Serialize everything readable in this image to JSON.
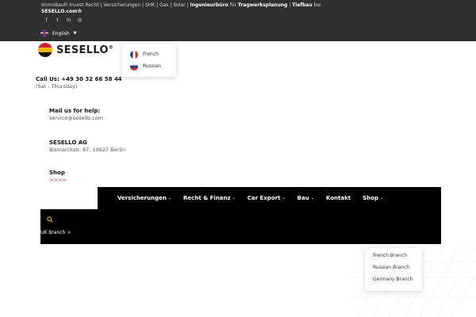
{
  "topbar": {
    "line1_prefix": "ImmoBauFi Invest Recht | Versicherungen | SHK | Gas | Solar |",
    "line1_bold1": "Ingenieurbüro",
    "line1_mid": "für",
    "line1_bold2": "Tragwerksplanung",
    "line1_sep": "|",
    "line1_bold3": "Tiefbau",
    "line1_end": "bei",
    "line2": "SESELLO.com®",
    "social": [
      "f",
      "t",
      "in",
      "ig"
    ],
    "language": "English"
  },
  "lang_dropdown": [
    {
      "label": "French"
    },
    {
      "label": "Russian"
    }
  ],
  "logo": {
    "text": "SESELLO",
    "mark": "®"
  },
  "contact": {
    "call_title": "Call Us: +49 30 32 66 58 44",
    "call_sub": "(Sat - Thursday)",
    "mail_title": "Mail us for help:",
    "mail_value": "service@sesello.com",
    "company_title": "SESELLO AG",
    "company_address": "Bismarckstr. 87, 10627 Berlin",
    "shop_title": "Shop",
    "shop_arrows": ">>>>"
  },
  "nav": [
    {
      "label": "Versicherungen",
      "chev": "⌄"
    },
    {
      "label": "Recht & Finanz",
      "chev": "⌄"
    },
    {
      "label": "Car Export",
      "chev": "⌄"
    },
    {
      "label": "Bau",
      "chev": "⌄"
    },
    {
      "label": "Kontakt",
      "chev": ""
    },
    {
      "label": "Shop",
      "chev": "⌄"
    }
  ],
  "branch": {
    "current": "UK Branch",
    "options": [
      "French Branch",
      "Russian Branch",
      "Germany Branch"
    ]
  },
  "colors": {
    "accent": "#e0262d",
    "search": "#f5b400"
  }
}
